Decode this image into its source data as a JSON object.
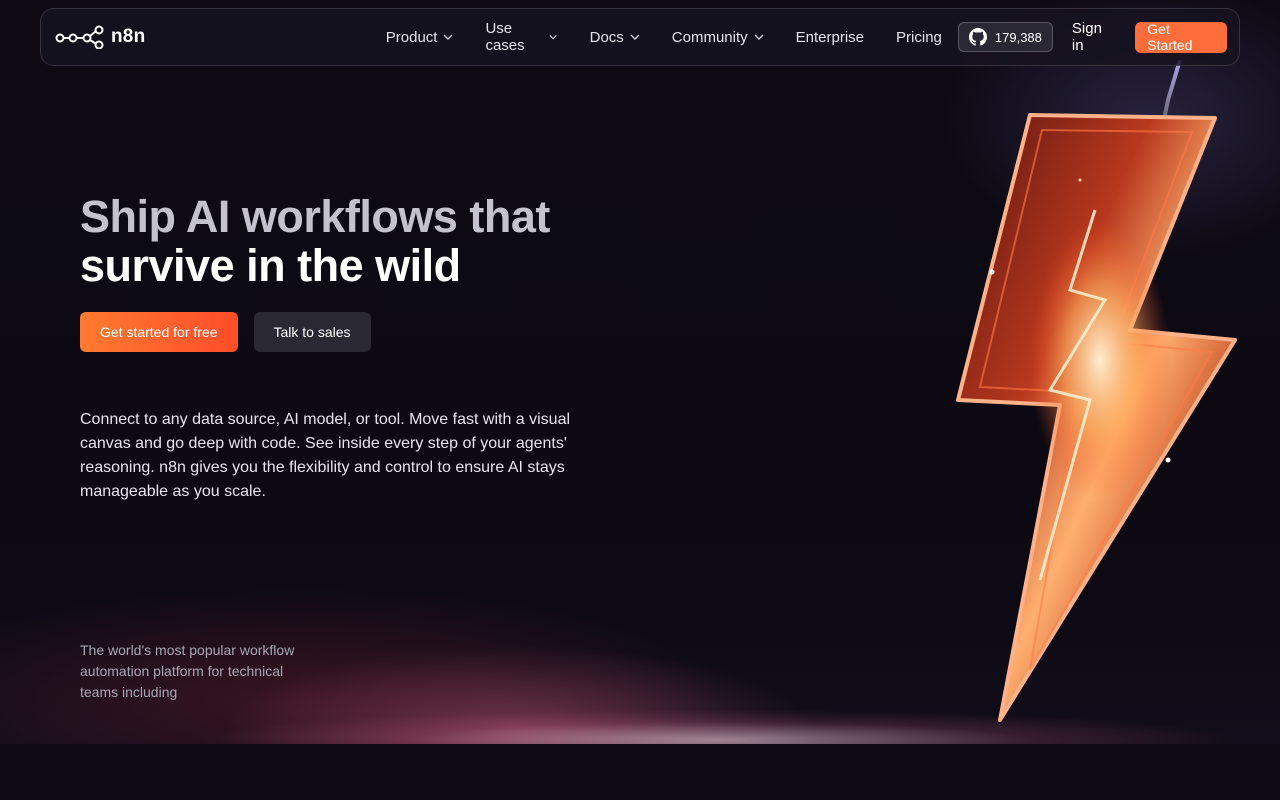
{
  "brand": {
    "name": "n8n",
    "logo_icon": "n8n-logo-icon"
  },
  "nav": {
    "items": [
      {
        "label": "Product",
        "has_dropdown": true
      },
      {
        "label": "Use cases",
        "has_dropdown": true
      },
      {
        "label": "Docs",
        "has_dropdown": true
      },
      {
        "label": "Community",
        "has_dropdown": true
      },
      {
        "label": "Enterprise",
        "has_dropdown": false
      },
      {
        "label": "Pricing",
        "has_dropdown": false
      }
    ],
    "github": {
      "icon": "github-icon",
      "stars": "179,388"
    },
    "signin_label": "Sign in",
    "get_started_label": "Get Started"
  },
  "hero": {
    "headline_line1": "Ship AI workflows that",
    "headline_line2": "survive in the wild",
    "cta_primary": "Get started for free",
    "cta_secondary": "Talk to sales",
    "description": "Connect to any data source, AI model, or tool. Move fast with a visual canvas and go deep with code. See inside every step of your agents' reasoning. n8n gives you the flexibility and control to ensure AI stays manageable as you scale.",
    "tagline": "The world's most popular workflow automation platform for technical teams including"
  },
  "colors": {
    "accent": "#ff6d3a",
    "background": "#0e0b17",
    "nav_bg": "#161320"
  }
}
